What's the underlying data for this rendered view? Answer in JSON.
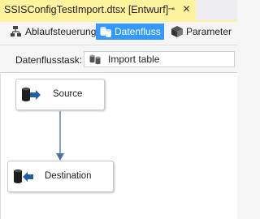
{
  "document_tab": {
    "title": "SSISConfigTestImport.dtsx [Entwurf]",
    "pin_symbol": "⊸",
    "close_symbol": "✕"
  },
  "designer_tabs": [
    {
      "label": "Ablaufsteuerung",
      "icon": "control-flow-icon",
      "active": false
    },
    {
      "label": "Datenfluss",
      "icon": "data-flow-icon",
      "active": true
    },
    {
      "label": "Parameter",
      "icon": "parameter-icon",
      "active": false
    }
  ],
  "task_bar": {
    "label": "Datenflusstask:",
    "selected_task": "Import table",
    "task_icon": "data-flow-task-icon"
  },
  "components": [
    {
      "label": "Source",
      "icon": "source-icon"
    },
    {
      "label": "Destination",
      "icon": "destination-icon"
    }
  ],
  "colors": {
    "tab_highlight": "#fff29d",
    "active_tab": "#3399ff",
    "connector": "#4a6fa5",
    "icon_blue": "#1f5fa8"
  }
}
